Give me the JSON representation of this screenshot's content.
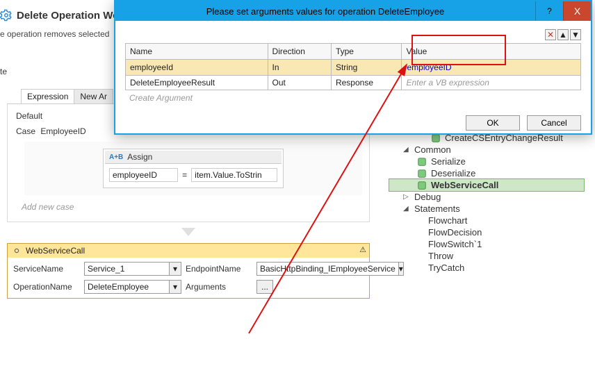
{
  "background": {
    "title": "Delete Operation Wo",
    "subtitle": "e operation removes selected",
    "delete_text": "te",
    "tabs": {
      "expression": "Expression",
      "new_arg": "New Ar"
    },
    "default_label": "Default",
    "case_label": "Case",
    "case_value": "EmployeeID",
    "assign": {
      "title": "Assign",
      "icon_label": "A+B",
      "left": "employeeID",
      "equals": "=",
      "right": "item.Value.ToStrin"
    },
    "add_new_case": "Add new case",
    "wsc": {
      "title": "WebServiceCall",
      "labels": {
        "service": "ServiceName",
        "endpoint": "EndpointName",
        "operation": "OperationName",
        "arguments": "Arguments"
      },
      "values": {
        "service": "Service_1",
        "endpoint": "BasicHttpBinding_IEmployeeService",
        "operation": "DeleteEmployee",
        "args_btn": "..."
      }
    }
  },
  "right_panel": {
    "items": [
      {
        "indent": "in3",
        "icon": "entry-icon",
        "label": "CreateCSEntryChangeResult"
      },
      {
        "indent": "in1",
        "icon": "tri",
        "label": "Common",
        "expanded": true
      },
      {
        "indent": "in2",
        "icon": "serialize-icon",
        "label": "Serialize"
      },
      {
        "indent": "in2",
        "icon": "deserialize-icon",
        "label": "Deserialize"
      },
      {
        "indent": "in2",
        "icon": "gear-icon",
        "label": "WebServiceCall",
        "selected": true
      },
      {
        "indent": "in1",
        "icon": "tri-closed",
        "label": "Debug"
      },
      {
        "indent": "in1",
        "icon": "tri",
        "label": "Statements",
        "expanded": true
      },
      {
        "indent": "in2",
        "icon": "",
        "label": "Flowchart"
      },
      {
        "indent": "in2",
        "icon": "",
        "label": "FlowDecision"
      },
      {
        "indent": "in2",
        "icon": "",
        "label": "FlowSwitch`1"
      },
      {
        "indent": "in2",
        "icon": "",
        "label": "Throw"
      },
      {
        "indent": "in2",
        "icon": "",
        "label": "TryCatch"
      }
    ]
  },
  "dialog": {
    "title": "Please set arguments values for operation DeleteEmployee",
    "help": "?",
    "close": "X",
    "columns": {
      "name": "Name",
      "direction": "Direction",
      "type": "Type",
      "value": "Value"
    },
    "rows": [
      {
        "name": "employeeId",
        "direction": "In",
        "type": "String",
        "value": "employeeID",
        "selected": true
      },
      {
        "name": "DeleteEmployeeResult",
        "direction": "Out",
        "type": "Response",
        "value_placeholder": "Enter a VB expression"
      }
    ],
    "create_argument": "Create Argument",
    "ok": "OK",
    "cancel": "Cancel"
  }
}
